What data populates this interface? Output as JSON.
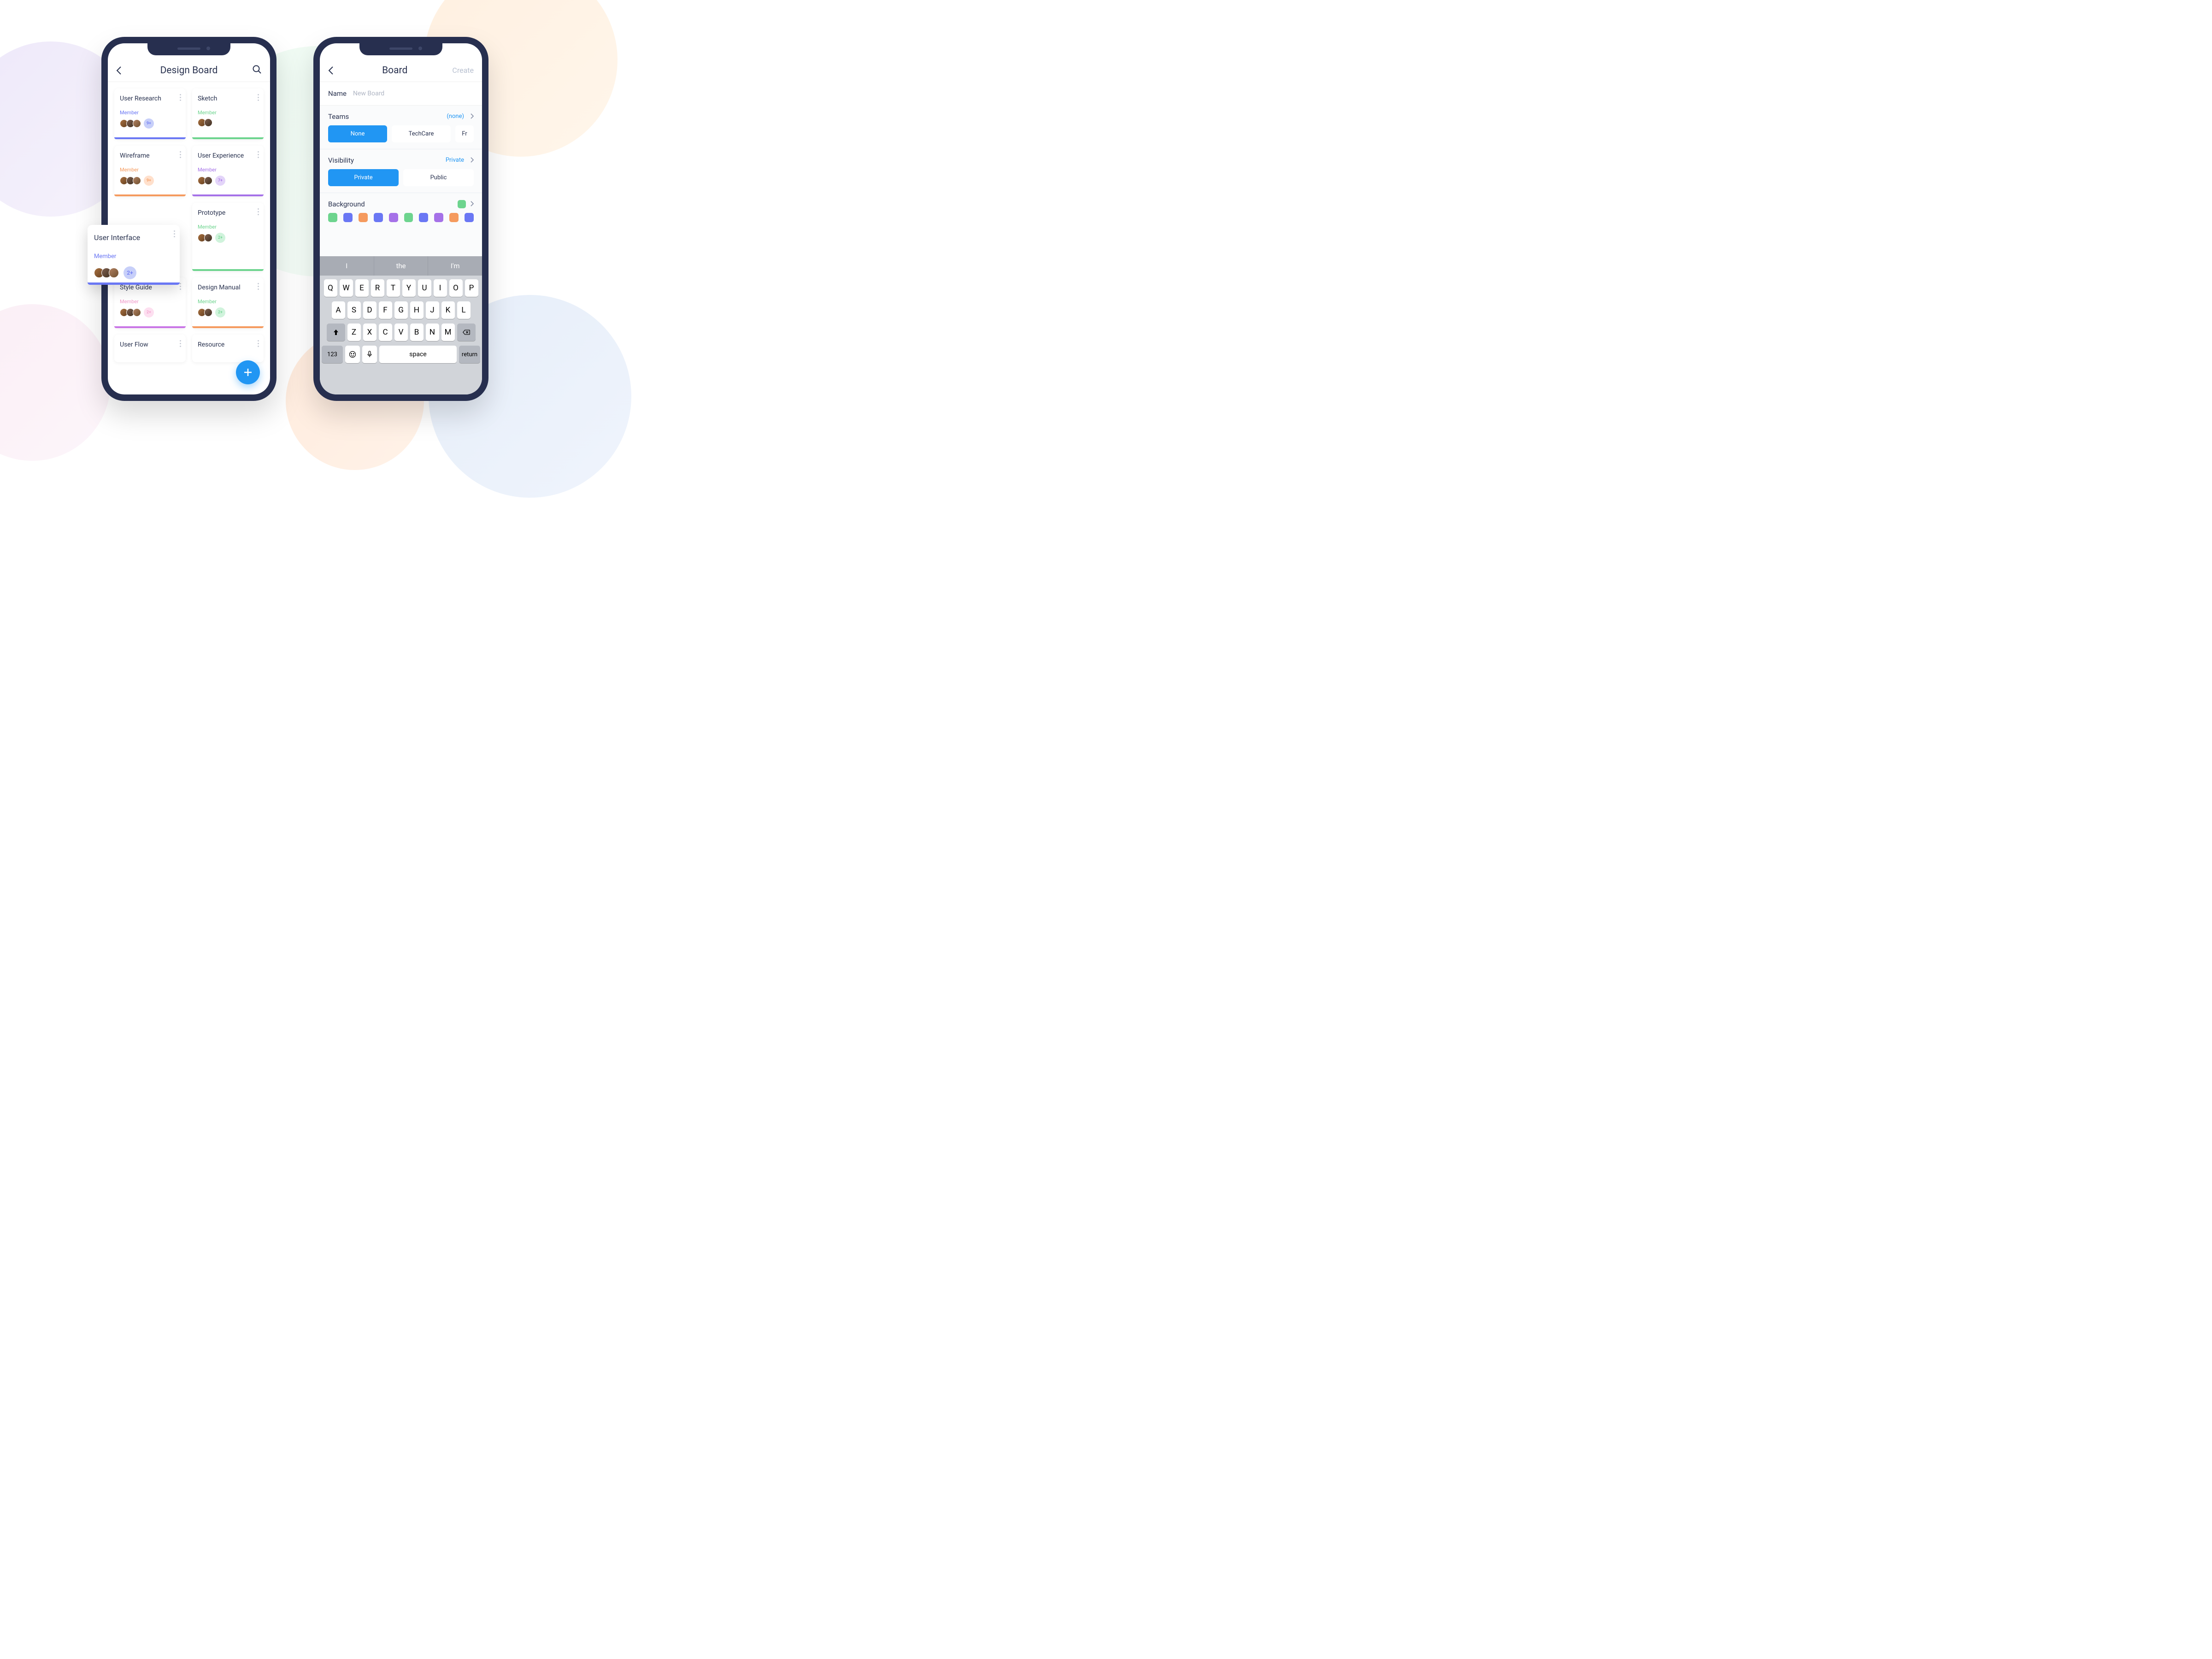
{
  "colors": {
    "blue": "#6a77f4",
    "green": "#6dd48e",
    "orange": "#f59a5e",
    "purple": "#a571e8",
    "pink": "#f29bcb",
    "teal": "#f29bcb",
    "brand": "#2196f3"
  },
  "left": {
    "title": "Design Board",
    "cards": [
      {
        "title": "User Research",
        "member_label": "Member",
        "label_color": "#6a77f4",
        "badge": "9+",
        "badge_bg": "#c7cff9",
        "badge_fg": "#6a77f4",
        "bar": "#6a77f4",
        "avatars": 3
      },
      {
        "title": "Sketch",
        "member_label": "Member",
        "label_color": "#6dd48e",
        "badge": "",
        "badge_bg": "",
        "badge_fg": "",
        "bar": "#6dd48e",
        "avatars": 2
      },
      {
        "title": "Wireframe",
        "member_label": "Member",
        "label_color": "#f59a5e",
        "badge": "9+",
        "badge_bg": "#ffe0cc",
        "badge_fg": "#f59a5e",
        "bar": "#f59a5e",
        "avatars": 3
      },
      {
        "title": "User Experience",
        "member_label": "Member",
        "label_color": "#a571e8",
        "badge": "7+",
        "badge_bg": "#e3d4f9",
        "badge_fg": "#a571e8",
        "bar": "#a571e8",
        "avatars": 2
      },
      {
        "title": "",
        "member_label": "",
        "label_color": "",
        "badge": "",
        "badge_bg": "",
        "badge_fg": "",
        "bar": "",
        "avatars": 0,
        "hidden": true
      },
      {
        "title": "Prototype",
        "member_label": "Member",
        "label_color": "#6dd48e",
        "badge": "2+",
        "badge_bg": "#d0f3dc",
        "badge_fg": "#6dd48e",
        "bar": "#6dd48e",
        "avatars": 2
      },
      {
        "title": "Style Guide",
        "member_label": "Member",
        "label_color": "#f29bcb",
        "badge": "2+",
        "badge_bg": "#fddff0",
        "badge_fg": "#f29bcb",
        "bar": "#c975e6",
        "avatars": 3
      },
      {
        "title": "Design Manual",
        "member_label": "Member",
        "label_color": "#6dd48e",
        "badge": "2+",
        "badge_bg": "#d0f3dc",
        "badge_fg": "#6dd48e",
        "bar": "#f59a5e",
        "avatars": 2
      },
      {
        "title": "User Flow",
        "member_label": "",
        "label_color": "",
        "badge": "",
        "badge_bg": "",
        "badge_fg": "",
        "bar": "",
        "avatars": 0
      },
      {
        "title": "Resource",
        "member_label": "",
        "label_color": "",
        "badge": "",
        "badge_bg": "",
        "badge_fg": "",
        "bar": "",
        "avatars": 0
      }
    ],
    "floating_card": {
      "title": "User Interface",
      "member_label": "Member",
      "label_color": "#6a77f4",
      "badge": "2+",
      "badge_bg": "#c7cff9",
      "badge_fg": "#6a77f4",
      "bar": "#6a77f4"
    }
  },
  "right": {
    "title": "Board",
    "create_label": "Create",
    "name": {
      "label": "Name",
      "placeholder": "New Board"
    },
    "teams": {
      "label": "Teams",
      "value": "(none)",
      "options": [
        "None",
        "TechCare",
        "Fr"
      ],
      "selected": "None"
    },
    "visibility": {
      "label": "Visibility",
      "value": "Private",
      "options": [
        "Private",
        "Public"
      ],
      "selected": "Private"
    },
    "background": {
      "label": "Background",
      "selected": "#6dd48e",
      "colors": [
        "#6dd48e",
        "#6a77f4",
        "#f59a5e",
        "#6a77f4",
        "#a571e8",
        "#6dd48e",
        "#6a77f4",
        "#a571e8",
        "#f59a5e",
        "#6a77f4"
      ]
    },
    "keyboard": {
      "suggestions": [
        "I",
        "the",
        "I'm"
      ],
      "row1": [
        "Q",
        "W",
        "E",
        "R",
        "T",
        "Y",
        "U",
        "I",
        "O",
        "P"
      ],
      "row2": [
        "A",
        "S",
        "D",
        "F",
        "G",
        "H",
        "J",
        "K",
        "L"
      ],
      "row3": [
        "Z",
        "X",
        "C",
        "V",
        "B",
        "N",
        "M"
      ],
      "numeric": "123",
      "space": "space",
      "return": "return"
    }
  }
}
